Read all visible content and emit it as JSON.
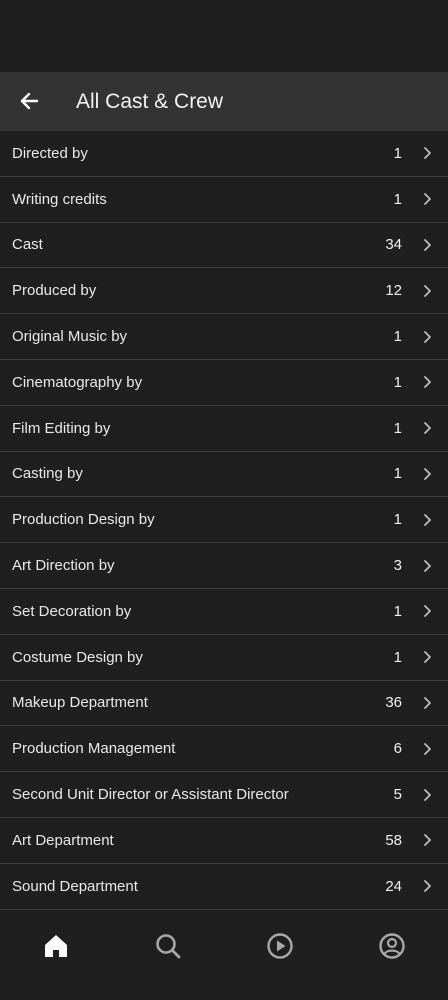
{
  "header": {
    "title": "All Cast & Crew",
    "back_icon": "arrow-left-icon"
  },
  "rows": [
    {
      "label": "Directed by",
      "count": "1"
    },
    {
      "label": "Writing credits",
      "count": "1"
    },
    {
      "label": "Cast",
      "count": "34"
    },
    {
      "label": "Produced by",
      "count": "12"
    },
    {
      "label": "Original Music by",
      "count": "1"
    },
    {
      "label": "Cinematography by",
      "count": "1"
    },
    {
      "label": "Film Editing by",
      "count": "1"
    },
    {
      "label": "Casting by",
      "count": "1"
    },
    {
      "label": "Production Design by",
      "count": "1"
    },
    {
      "label": "Art Direction by",
      "count": "3"
    },
    {
      "label": "Set Decoration by",
      "count": "1"
    },
    {
      "label": "Costume Design by",
      "count": "1"
    },
    {
      "label": "Makeup Department",
      "count": "36"
    },
    {
      "label": "Production Management",
      "count": "6"
    },
    {
      "label": "Second Unit Director or Assistant Director",
      "count": "5"
    },
    {
      "label": "Art Department",
      "count": "58"
    },
    {
      "label": "Sound Department",
      "count": "24"
    }
  ],
  "bottom_nav": {
    "items": [
      {
        "icon": "home-icon",
        "active": true
      },
      {
        "icon": "search-icon",
        "active": false
      },
      {
        "icon": "play-circle-icon",
        "active": false
      },
      {
        "icon": "account-icon",
        "active": false
      }
    ]
  },
  "colors": {
    "background": "#1f1f1f",
    "app_bar": "#333333",
    "divider": "#3d3d3d",
    "text": "#ededed",
    "icon_inactive": "#a8a8a8"
  }
}
